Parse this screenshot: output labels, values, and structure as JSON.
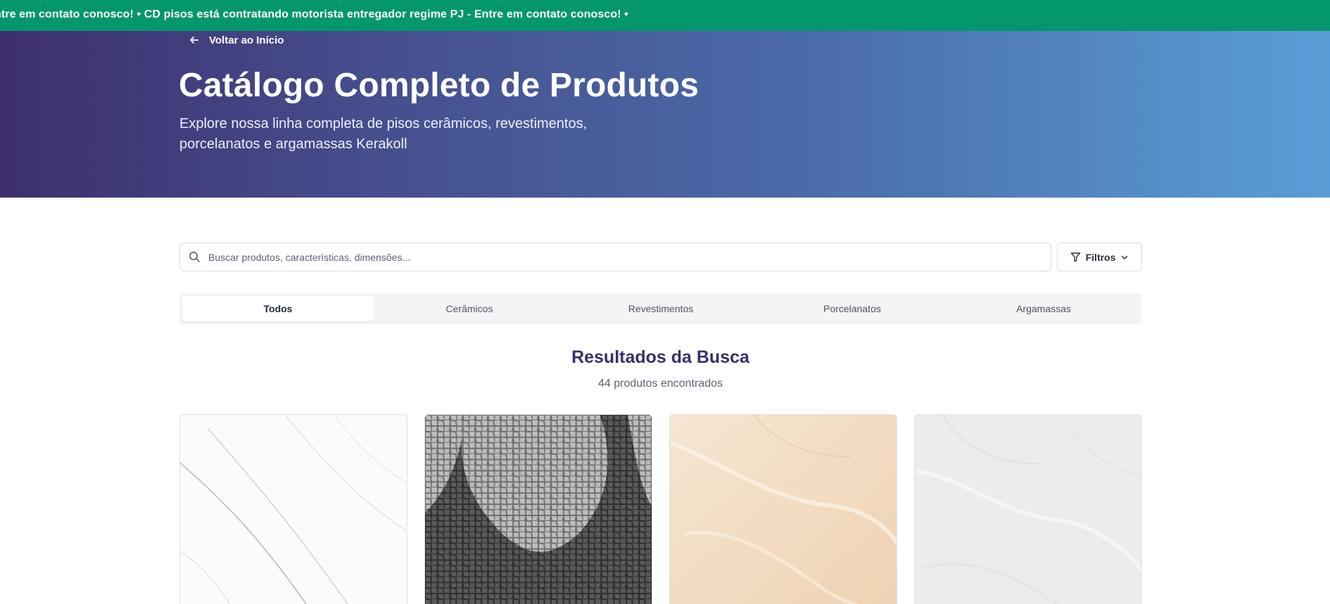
{
  "ticker": {
    "text": "ntre em contato conosco! • CD pisos está contratando motorista entregador regime PJ - Entre em contato conosco! •"
  },
  "hero": {
    "back_label": "Voltar ao Início",
    "title": "Catálogo Completo de Produtos",
    "subtitle_line1": "Explore nossa linha completa de pisos cerâmicos, revestimentos,",
    "subtitle_line2": "porcelanatos e argamassas Kerakoll"
  },
  "search": {
    "placeholder": "Buscar produtos, características, dimensões...",
    "value": ""
  },
  "filters": {
    "label": "Filtros"
  },
  "tabs": [
    {
      "label": "Todos",
      "active": true
    },
    {
      "label": "Cerâmicos",
      "active": false
    },
    {
      "label": "Revestimentos",
      "active": false
    },
    {
      "label": "Porcelanatos",
      "active": false
    },
    {
      "label": "Argamassas",
      "active": false
    }
  ],
  "results": {
    "title": "Resultados da Busca",
    "count_text": "44 produtos encontrados"
  },
  "products": [
    {
      "image": "white-marble-tile"
    },
    {
      "image": "portuguese-mosaic-tile"
    },
    {
      "image": "beige-marble-tile"
    },
    {
      "image": "light-gray-marble-tile"
    }
  ],
  "colors": {
    "ticker_bg": "#04976b",
    "hero_gradient_start": "#3e2f6f",
    "hero_gradient_end": "#5a9ed7",
    "heading_accent": "#3b2d6b"
  }
}
